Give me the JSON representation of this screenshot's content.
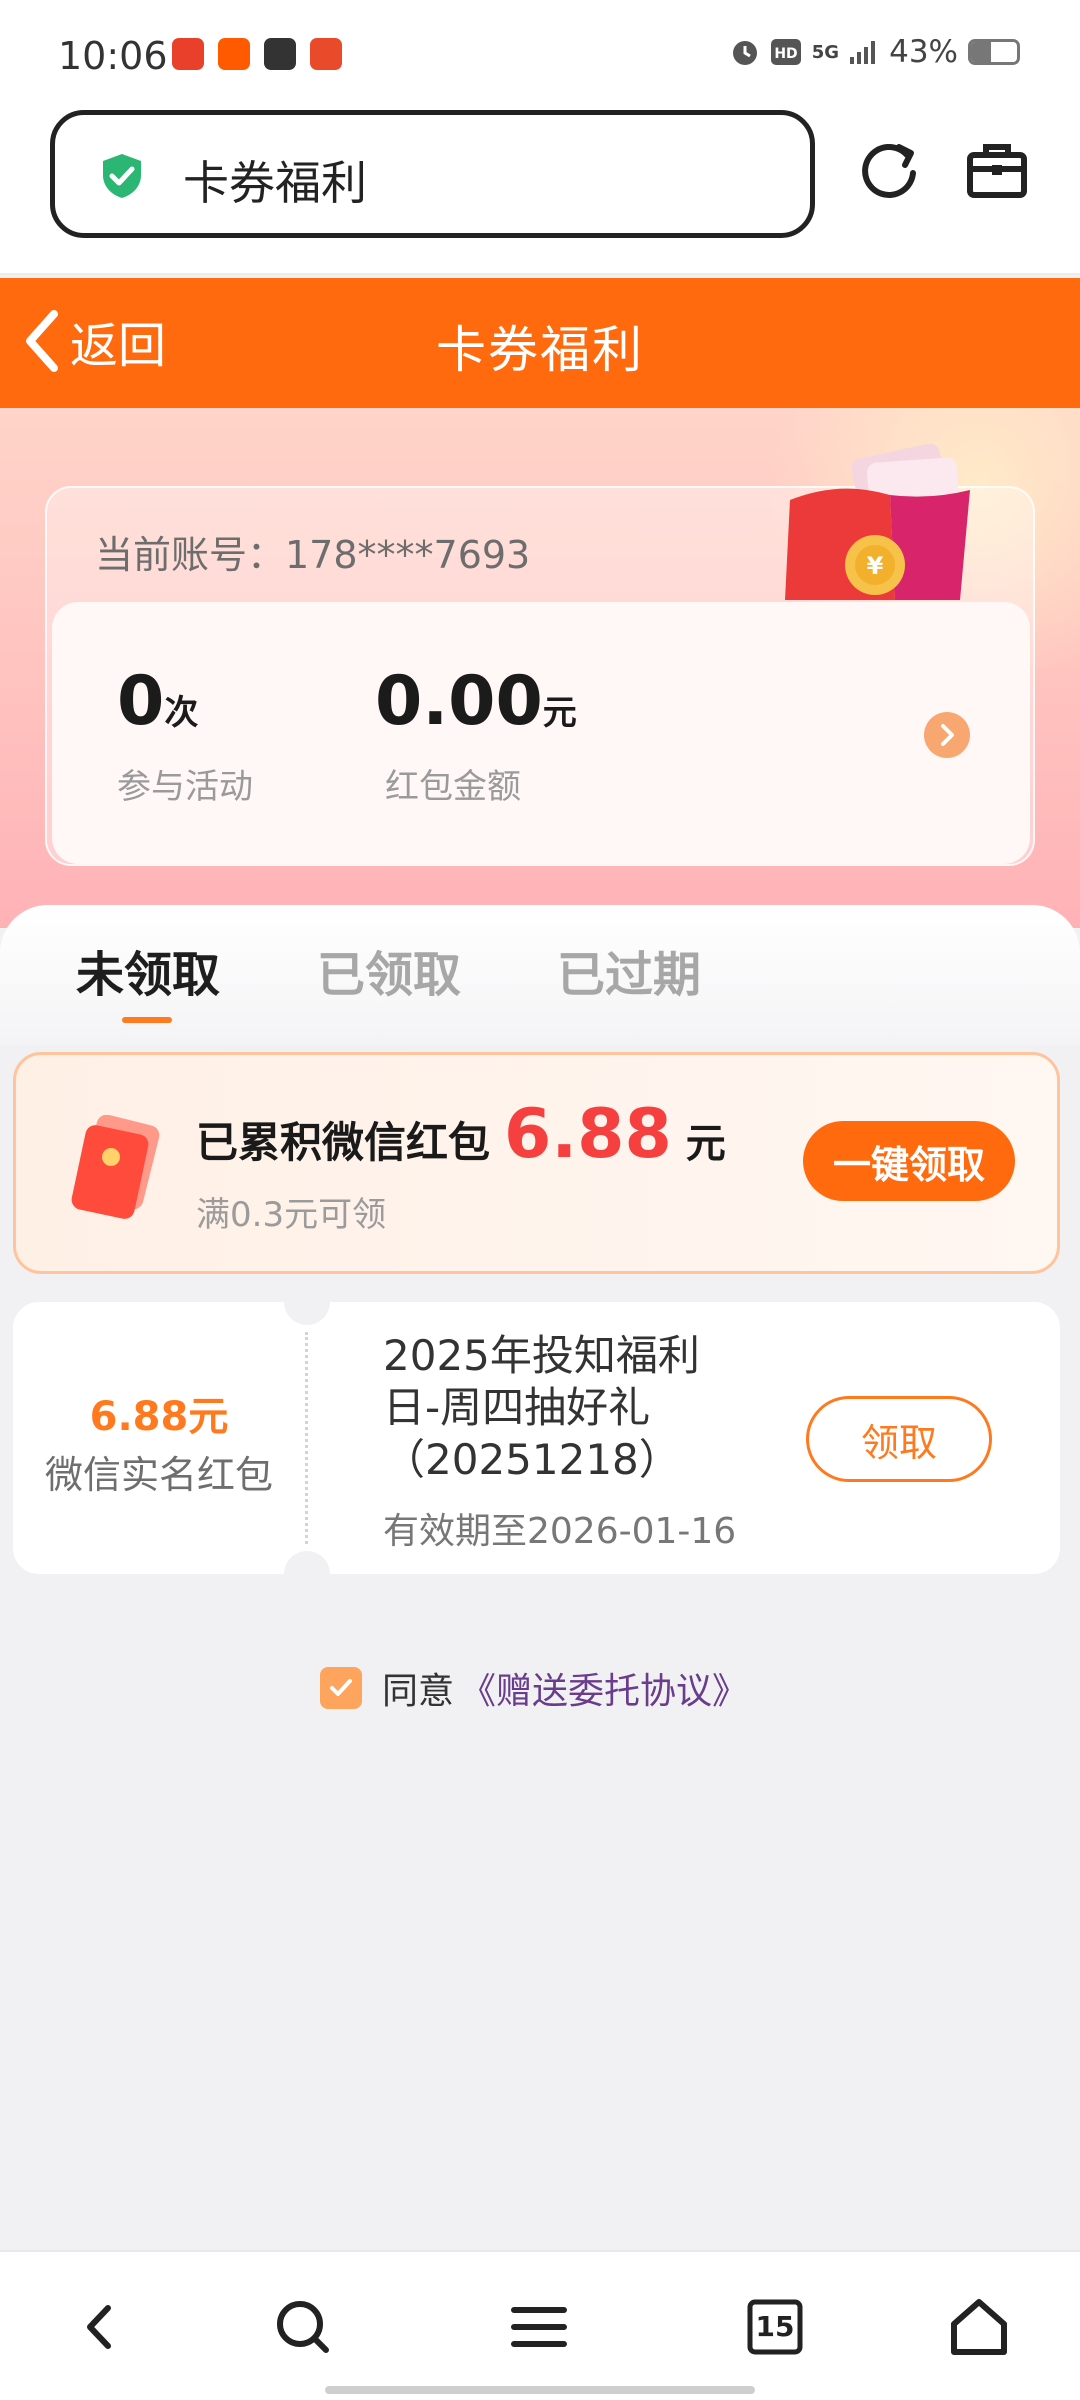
{
  "status_bar": {
    "time": "10:06",
    "network": "5G",
    "battery_text": "43%",
    "battery_level": 0.43,
    "icons": [
      "app-icon-1",
      "taobao-icon",
      "video-icon",
      "app-icon-4",
      "alarm-icon",
      "hd-icon",
      "signal-icon",
      "battery-icon"
    ]
  },
  "browser": {
    "url_text": "卡券福利",
    "shield_color": "#2bb673"
  },
  "header": {
    "back_label": "返回",
    "title": "卡券福利",
    "background_color": "#ff6a0e"
  },
  "account": {
    "label": "当前账号：178****7693",
    "participation_count": "0",
    "participation_unit": "次",
    "participation_label": "参与活动",
    "redpacket_amount": "0.00",
    "redpacket_unit": "元",
    "redpacket_label": "红包金额"
  },
  "tabs": [
    {
      "label": "未领取",
      "active": true
    },
    {
      "label": "已领取",
      "active": false
    },
    {
      "label": "已过期",
      "active": false
    }
  ],
  "accumulated": {
    "title": "已累积微信红包",
    "amount": "6.88",
    "unit": "元",
    "subtitle": "满0.3元可领",
    "button_label": "一键领取",
    "amount_color": "#f6403f"
  },
  "coupons": [
    {
      "amount": "6.88元",
      "type": "微信实名红包",
      "title_lines": [
        "2025年投知福利",
        "日-周四抽好礼",
        "（20251218）"
      ],
      "expiry": "有效期至2026-01-16",
      "button_label": "领取"
    }
  ],
  "agreement": {
    "checked": true,
    "text": "同意",
    "link_text": "《赠送委托协议》"
  },
  "bottom_nav": {
    "tab_count": "15",
    "icons": [
      "back-icon",
      "search-icon",
      "menu-icon",
      "tabs-icon",
      "home-icon"
    ]
  }
}
